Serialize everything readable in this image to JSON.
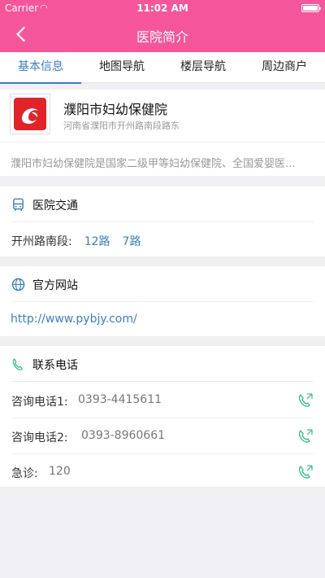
{
  "status": {
    "carrier": "Carrier",
    "time": "11:02 AM"
  },
  "nav": {
    "title": "医院简介"
  },
  "tabs": [
    "基本信息",
    "地图导航",
    "楼层导航",
    "周边商户"
  ],
  "hospital": {
    "name": "濮阳市妇幼保健院",
    "address": "河南省濮阳市开州路南段路东",
    "description": "濮阳市妇幼保健院是国家二级甲等妇幼保健院、全国爱婴医..."
  },
  "traffic": {
    "title": "医院交通",
    "stop": "开州路南段:",
    "routes": [
      "12路",
      "7路"
    ]
  },
  "website": {
    "title": "官方网站",
    "url": "http://www.pybjy.com/"
  },
  "contact": {
    "title": "联系电话",
    "rows": [
      {
        "label": "咨询电话1:",
        "number": "0393-4415611"
      },
      {
        "label": "咨询电话2:",
        "number": "0393-8960661"
      },
      {
        "label": "急诊:",
        "number": "120"
      }
    ]
  },
  "colors": {
    "brand": "#f5569a",
    "accent": "#3a7fc1",
    "phone_icon": "#3bbd9a"
  },
  "icons": {
    "back": "chevron-left-icon",
    "bus": "bus-icon",
    "globe": "globe-icon",
    "phone_handset": "phone-handset-icon",
    "call": "call-icon",
    "logo": "hospital-logo"
  }
}
